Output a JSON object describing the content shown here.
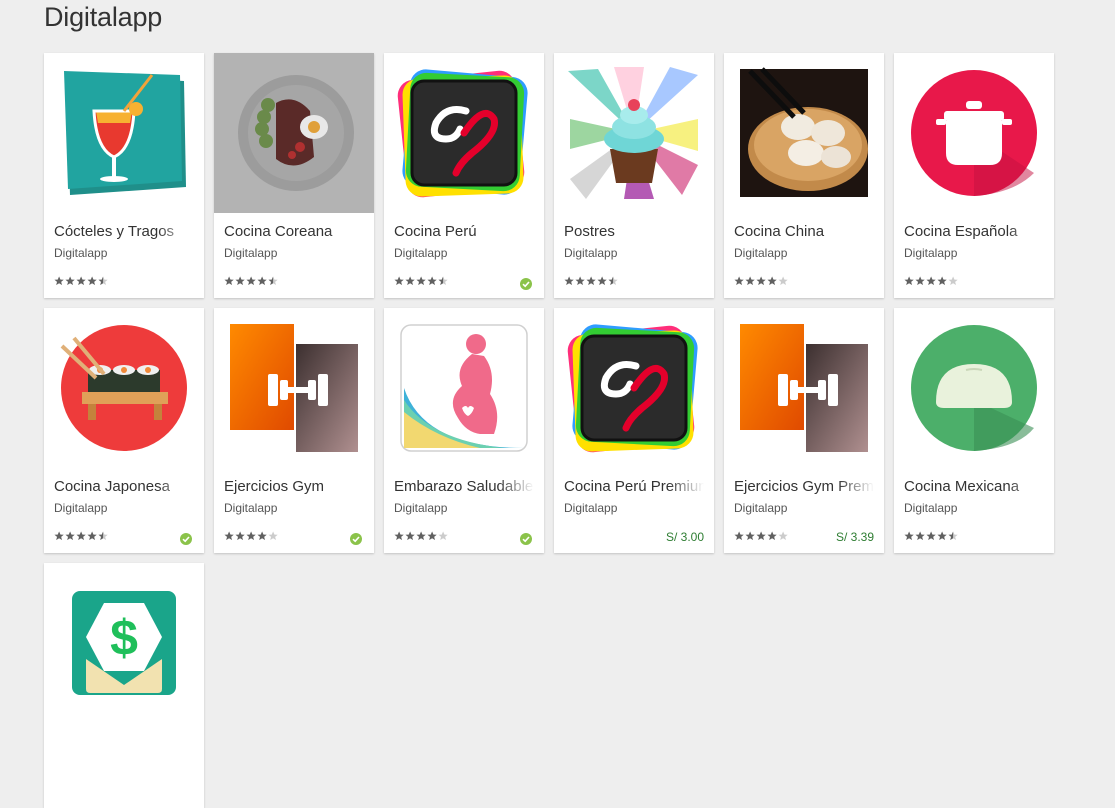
{
  "page": {
    "title": "Digitalapp"
  },
  "colors": {
    "star": "#616161",
    "star_empty": "#cccccc",
    "badge": "#8bc34a",
    "price": "#2e7d32"
  },
  "apps": [
    {
      "id": "cocteles",
      "title": "Cócteles y Tragos",
      "developer": "Digitalapp",
      "rating": 4.5,
      "icon": "cocktail-icon"
    },
    {
      "id": "coreana",
      "title": "Cocina Coreana",
      "developer": "Digitalapp",
      "rating": 4.5,
      "icon": "korean-plate-icon"
    },
    {
      "id": "peru",
      "title": "Cocina Perú",
      "developer": "Digitalapp",
      "rating": 4.5,
      "badge": true,
      "icon": "cp-logo-icon"
    },
    {
      "id": "postres",
      "title": "Postres",
      "developer": "Digitalapp",
      "rating": 4.5,
      "icon": "cupcake-icon"
    },
    {
      "id": "china",
      "title": "Cocina China",
      "developer": "Digitalapp",
      "rating": 4,
      "icon": "dumplings-icon"
    },
    {
      "id": "espanola",
      "title": "Cocina Española",
      "developer": "Digitalapp",
      "rating": 4,
      "icon": "pot-icon"
    },
    {
      "id": "japonesa",
      "title": "Cocina Japonesa",
      "developer": "Digitalapp",
      "rating": 4.5,
      "badge": true,
      "icon": "sushi-icon"
    },
    {
      "id": "gym",
      "title": "Ejercicios Gym",
      "developer": "Digitalapp",
      "rating": 4,
      "badge": true,
      "icon": "dumbbell-icon"
    },
    {
      "id": "embarazo",
      "title": "Embarazo Saludable",
      "developer": "Digitalapp",
      "rating": 4,
      "badge": true,
      "icon": "pregnancy-icon"
    },
    {
      "id": "peru-premium",
      "title": "Cocina Perú Premium",
      "developer": "Digitalapp",
      "price": "S/ 3.00",
      "icon": "cp-logo-icon"
    },
    {
      "id": "gym-premium",
      "title": "Ejercicios Gym Premium",
      "developer": "Digitalapp",
      "rating": 4,
      "price": "S/ 3.39",
      "icon": "dumbbell-icon"
    },
    {
      "id": "mexicana",
      "title": "Cocina Mexicana",
      "developer": "Digitalapp",
      "rating": 4.5,
      "icon": "taco-icon"
    },
    {
      "id": "finanzas",
      "title": "",
      "developer": "",
      "icon": "dollar-icon"
    }
  ]
}
